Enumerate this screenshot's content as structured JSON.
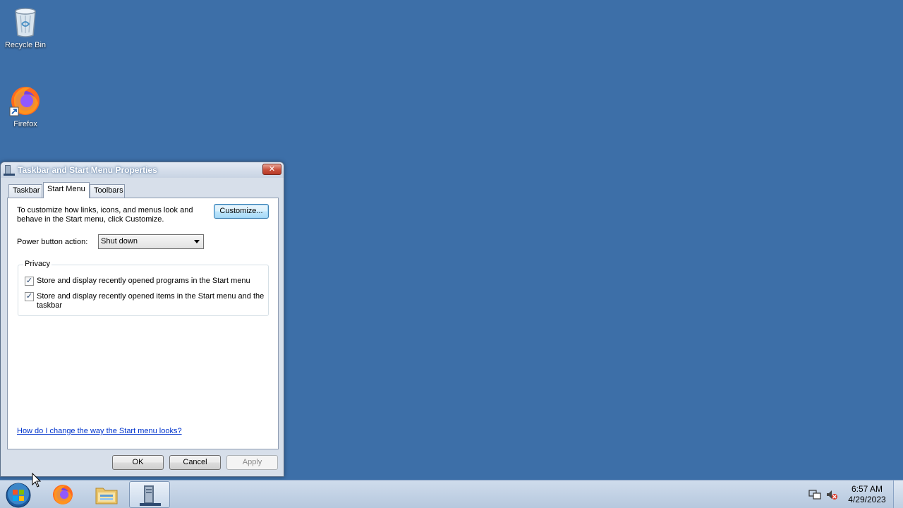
{
  "desktop": {
    "icons": [
      {
        "label": "Recycle Bin",
        "icon": "recycle-bin-icon"
      },
      {
        "label": "Firefox",
        "icon": "firefox-icon"
      }
    ]
  },
  "dialog": {
    "title": "Taskbar and Start Menu Properties",
    "tabs": [
      {
        "label": "Taskbar",
        "active": false
      },
      {
        "label": "Start Menu",
        "active": true
      },
      {
        "label": "Toolbars",
        "active": false
      }
    ],
    "description": "To customize how links, icons, and menus look and behave in the Start menu, click Customize.",
    "customize_label": "Customize...",
    "power_label": "Power button action:",
    "power_value": "Shut down",
    "privacy": {
      "label": "Privacy",
      "items": [
        {
          "label": "Store and display recently opened programs in the Start menu",
          "checked": true
        },
        {
          "label": "Store and display recently opened items in the Start menu and the taskbar",
          "checked": true
        }
      ]
    },
    "help_link": "How do I change the way the Start menu looks?",
    "buttons": {
      "ok": "OK",
      "cancel": "Cancel",
      "apply": "Apply"
    }
  },
  "taskbar": {
    "items": [
      "start-orb",
      "firefox-icon",
      "explorer-folder-icon",
      "properties-icon"
    ],
    "clock": {
      "time": "6:57 AM",
      "date": "4/29/2023"
    }
  },
  "colors": {
    "desktop": "#3d6fa8",
    "link": "#0033cc",
    "check": "#1f3f6a"
  }
}
